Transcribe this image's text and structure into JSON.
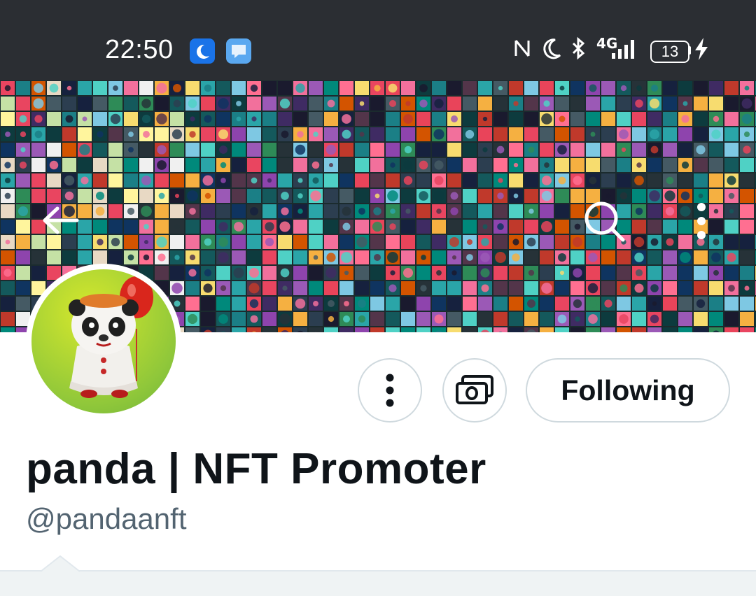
{
  "status_bar": {
    "time": "22:50",
    "network": "4G",
    "battery": "13",
    "icons": [
      "moon-app-icon",
      "chat-app-icon",
      "nfc-icon",
      "do-not-disturb-icon",
      "bluetooth-icon",
      "signal-icon",
      "battery-icon",
      "charging-icon"
    ]
  },
  "header": {
    "back_icon": "arrow-left-icon",
    "search_icon": "search-icon",
    "more_icon": "more-vertical-icon"
  },
  "profile": {
    "display_name": "panda | NFT Promoter",
    "handle": "@pandaanft",
    "following_label": "Following",
    "more_button_icon": "more-vertical-icon",
    "tip_button_icon": "money-icon"
  },
  "colors": {
    "status_bar_bg": "#2b2e33",
    "border": "#cfd9de",
    "text_primary": "#0f1419",
    "text_secondary": "#536471",
    "strip": "#eff3f4"
  }
}
